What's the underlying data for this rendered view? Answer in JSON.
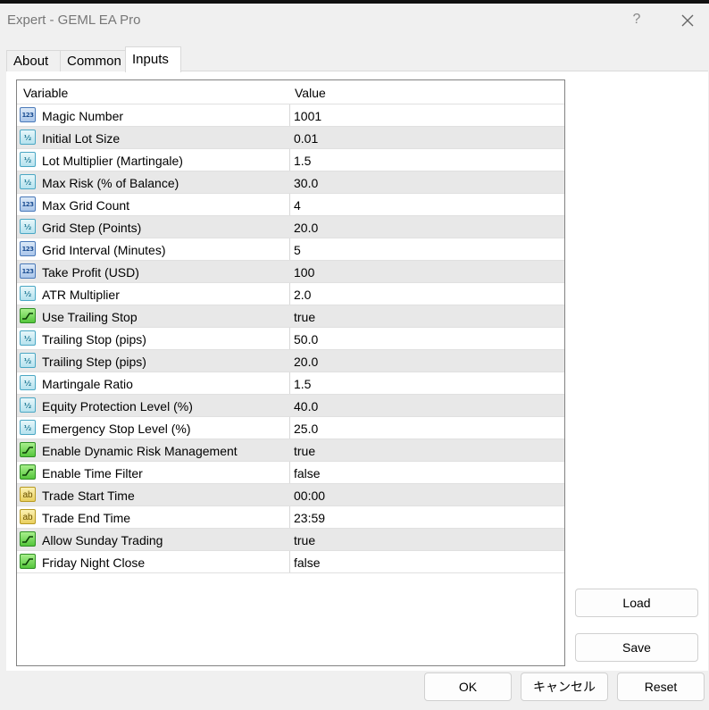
{
  "window": {
    "title": "Expert - GEML EA Pro",
    "help_label": "?"
  },
  "tabs": [
    {
      "label": "About",
      "active": false
    },
    {
      "label": "Common",
      "active": false
    },
    {
      "label": "Inputs",
      "active": true
    }
  ],
  "table": {
    "headers": {
      "variable": "Variable",
      "value": "Value"
    },
    "rows": [
      {
        "type": "int",
        "icon": "int-type-icon",
        "name": "Magic Number",
        "value": "1001"
      },
      {
        "type": "double",
        "icon": "double-type-icon",
        "name": "Initial Lot Size",
        "value": "0.01"
      },
      {
        "type": "double",
        "icon": "double-type-icon",
        "name": "Lot Multiplier (Martingale)",
        "value": "1.5"
      },
      {
        "type": "double",
        "icon": "double-type-icon",
        "name": "Max Risk (% of Balance)",
        "value": "30.0"
      },
      {
        "type": "int",
        "icon": "int-type-icon",
        "name": "Max Grid Count",
        "value": "4"
      },
      {
        "type": "double",
        "icon": "double-type-icon",
        "name": "Grid Step (Points)",
        "value": "20.0"
      },
      {
        "type": "int",
        "icon": "int-type-icon",
        "name": "Grid Interval (Minutes)",
        "value": "5"
      },
      {
        "type": "int",
        "icon": "int-type-icon",
        "name": "Take Profit (USD)",
        "value": "100"
      },
      {
        "type": "double",
        "icon": "double-type-icon",
        "name": "ATR Multiplier",
        "value": "2.0"
      },
      {
        "type": "bool",
        "icon": "bool-type-icon",
        "name": "Use Trailing Stop",
        "value": "true"
      },
      {
        "type": "double",
        "icon": "double-type-icon",
        "name": "Trailing Stop (pips)",
        "value": "50.0"
      },
      {
        "type": "double",
        "icon": "double-type-icon",
        "name": "Trailing Step (pips)",
        "value": "20.0"
      },
      {
        "type": "double",
        "icon": "double-type-icon",
        "name": "Martingale Ratio",
        "value": "1.5"
      },
      {
        "type": "double",
        "icon": "double-type-icon",
        "name": "Equity Protection Level (%)",
        "value": "40.0"
      },
      {
        "type": "double",
        "icon": "double-type-icon",
        "name": "Emergency Stop Level (%)",
        "value": "25.0"
      },
      {
        "type": "bool",
        "icon": "bool-type-icon",
        "name": "Enable Dynamic Risk Management",
        "value": "true"
      },
      {
        "type": "bool",
        "icon": "bool-type-icon",
        "name": "Enable Time Filter",
        "value": "false"
      },
      {
        "type": "string",
        "icon": "string-type-icon",
        "name": "Trade Start Time",
        "value": "00:00"
      },
      {
        "type": "string",
        "icon": "string-type-icon",
        "name": "Trade End Time",
        "value": "23:59"
      },
      {
        "type": "bool",
        "icon": "bool-type-icon",
        "name": "Allow Sunday Trading",
        "value": "true"
      },
      {
        "type": "bool",
        "icon": "bool-type-icon",
        "name": "Friday Night Close",
        "value": "false"
      }
    ]
  },
  "buttons": {
    "load": "Load",
    "save": "Save",
    "ok": "OK",
    "cancel": "キャンセル",
    "reset": "Reset"
  },
  "icon_glyphs": {
    "int": "123",
    "double": "½",
    "string": "ab"
  },
  "colors": {
    "row_alt": "#e8e8e8",
    "grid_border": "#828282",
    "window_bg": "#f0f0f0"
  }
}
